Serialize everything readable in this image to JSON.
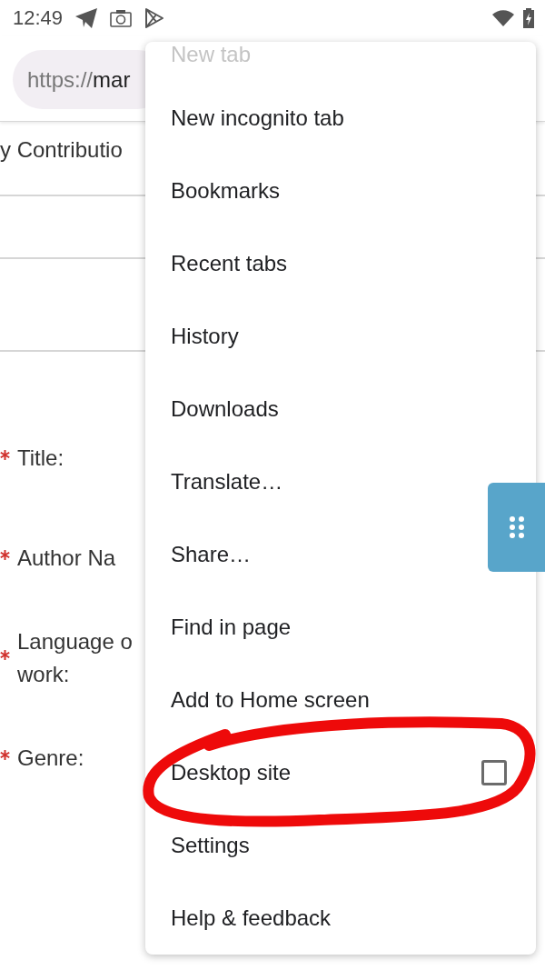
{
  "status_bar": {
    "time": "12:49"
  },
  "address_bar": {
    "scheme": "https://",
    "host": "mar"
  },
  "page": {
    "heading": "y Contributio",
    "fields": [
      {
        "required": true,
        "lines": [
          "Title:"
        ]
      },
      {
        "required": true,
        "lines": [
          "Author Na"
        ]
      },
      {
        "required": true,
        "lines": [
          "Language o",
          "work:"
        ]
      },
      {
        "required": true,
        "lines": [
          "Genre:"
        ]
      }
    ]
  },
  "menu": {
    "items": [
      {
        "label": "New tab",
        "kind": "faded",
        "circled": false
      },
      {
        "label": "New incognito tab",
        "kind": "action",
        "circled": false
      },
      {
        "label": "Bookmarks",
        "kind": "action",
        "circled": false
      },
      {
        "label": "Recent tabs",
        "kind": "action",
        "circled": false
      },
      {
        "label": "History",
        "kind": "action",
        "circled": false
      },
      {
        "label": "Downloads",
        "kind": "action",
        "circled": false
      },
      {
        "label": "Translate…",
        "kind": "action",
        "circled": false
      },
      {
        "label": "Share…",
        "kind": "action",
        "circled": false
      },
      {
        "label": "Find in page",
        "kind": "action",
        "circled": false
      },
      {
        "label": "Add to Home screen",
        "kind": "action",
        "circled": false
      },
      {
        "label": "Desktop site",
        "kind": "checkbox",
        "checked": false,
        "circled": true
      },
      {
        "label": "Settings",
        "kind": "action",
        "circled": false
      },
      {
        "label": "Help & feedback",
        "kind": "action",
        "circled": false
      }
    ]
  }
}
